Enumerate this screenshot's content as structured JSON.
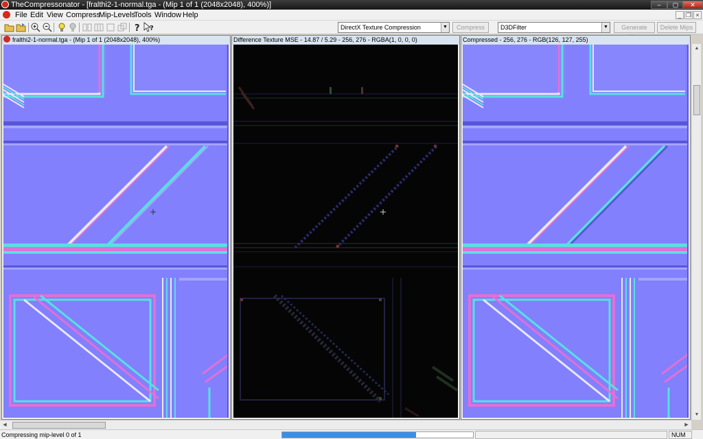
{
  "window": {
    "title": "TheCompressonator - [fralthi2-1-normal.tga - (Mip 1 of 1 (2048x2048), 400%)]",
    "min_label": "–",
    "max_label": "▢",
    "close_label": "✕"
  },
  "menu": {
    "items": [
      "File",
      "Edit",
      "View",
      "Compress",
      "Mip-Levels",
      "Tools",
      "Window",
      "Help"
    ],
    "mdi_min": "_",
    "mdi_restore": "❐",
    "mdi_close": "×"
  },
  "toolbar": {
    "compression_select": {
      "value": "DirectX Texture Compression"
    },
    "compress_label": "Compress",
    "filter_select": {
      "value": "D3DFilter"
    },
    "generate_mips_label": "Generate Mips",
    "delete_mips_label": "Delete Mips"
  },
  "panes": {
    "original": {
      "caption": "fralthi2-1-normal.tga - (Mip 1 of 1 (2048x2048), 400%)"
    },
    "difference": {
      "caption": "Difference Texture MSE - 14.87 / 5.29 - 256, 276 - RGBA(1, 0, 0, 0)"
    },
    "compressed": {
      "caption": "Compressed - 256, 276 - RGB(126, 127, 255)"
    }
  },
  "status": {
    "message": "Compressing mip-level 0 of 1",
    "progress_fraction": 0.7,
    "num_indicator": "NUM"
  },
  "colors": {
    "normal_base": "#8280fc",
    "normal_light": "#a6a4ff",
    "normal_dark": "#5a56d8",
    "edge_cyan": "#58e0e0",
    "edge_magenta": "#e070d8",
    "edge_white": "#e8e8ff",
    "diff_bg": "#050505"
  }
}
